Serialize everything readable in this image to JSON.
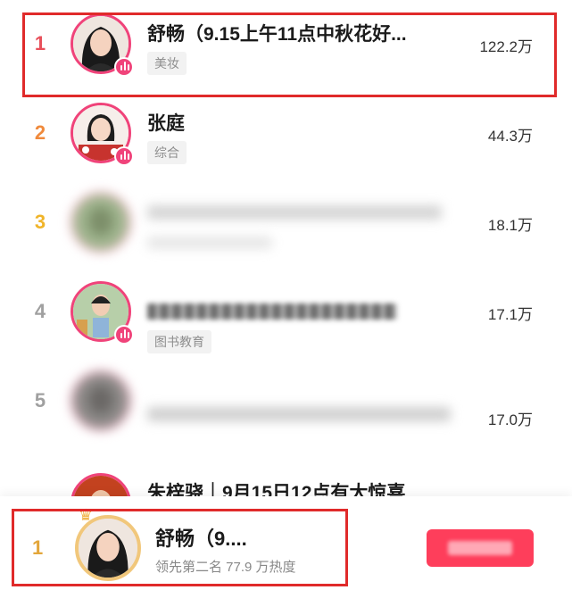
{
  "ranking": {
    "rows": [
      {
        "rank": "1",
        "name": "舒畅（9.15上午11点中秋花好...",
        "tag": "美妆",
        "count": "122.2万"
      },
      {
        "rank": "2",
        "name": "张庭",
        "tag": "综合",
        "count": "44.3万"
      },
      {
        "rank": "3",
        "name": "",
        "tag": "",
        "count": "18.1万"
      },
      {
        "rank": "4",
        "name": "",
        "tag": "图书教育",
        "count": "17.1万"
      },
      {
        "rank": "5",
        "name": "",
        "tag": "",
        "count": "17.0万"
      },
      {
        "rank": "",
        "name": "朱梓骁｜9月15日12点有大惊喜",
        "tag": "",
        "count": ""
      }
    ],
    "rank_colors": [
      "#e8505b",
      "#f08a3c",
      "#f0b429",
      "#a0a0a0",
      "#a0a0a0"
    ]
  },
  "footer": {
    "rank": "1",
    "name": "舒畅（9....",
    "subtitle": "领先第二名 77.9 万热度",
    "button_label": ""
  },
  "colors": {
    "accent_pink": "#f0437a",
    "button_red": "#fe3e5b",
    "highlight_red": "#e02a2a",
    "gold": "#e3a63a"
  },
  "icons": [
    "live-indicator-icon",
    "crown-icon"
  ]
}
